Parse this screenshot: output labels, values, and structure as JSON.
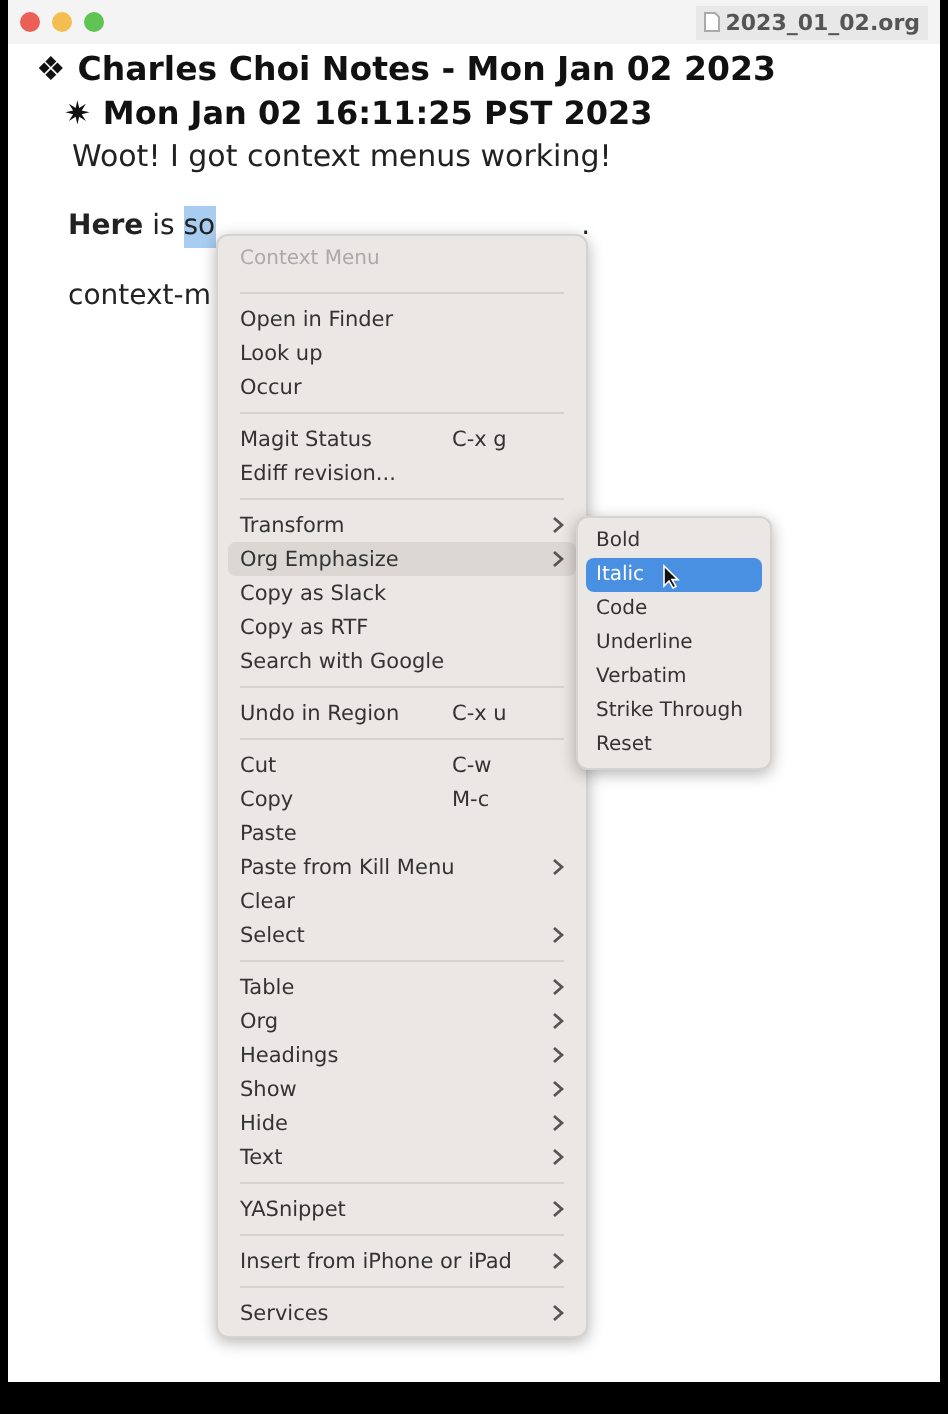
{
  "window": {
    "title": "2023_01_02.org"
  },
  "document": {
    "heading_1": {
      "bullet": "❖",
      "text": "Charles Choi Notes - Mon Jan 02 2023"
    },
    "heading_2": {
      "bullet": "✷",
      "text": "Mon Jan 02 16:11:25 PST 2023"
    },
    "line_1": "Woot! I got context menus working!",
    "line_2": {
      "bold": "Here",
      "plain": " is ",
      "selected_text": "so",
      "end": "."
    },
    "line_3": "context-m"
  },
  "context_menu": {
    "title": "Context Menu",
    "sections": [
      [
        {
          "label": "Open in Finder",
          "submenu": false,
          "selected": false
        },
        {
          "label": "Look up",
          "submenu": false,
          "selected": false
        },
        {
          "label": "Occur",
          "submenu": false,
          "selected": false
        }
      ],
      [
        {
          "label": "Magit Status",
          "shortcut": "C-x g",
          "submenu": false,
          "selected": false
        },
        {
          "label": "Ediff revision...",
          "submenu": false,
          "selected": false
        }
      ],
      [
        {
          "label": "Transform",
          "submenu": true,
          "selected": false
        },
        {
          "label": "Org Emphasize",
          "submenu": true,
          "selected": true
        },
        {
          "label": "Copy as Slack",
          "submenu": false,
          "selected": false
        },
        {
          "label": "Copy as RTF",
          "submenu": false,
          "selected": false
        },
        {
          "label": "Search with Google",
          "submenu": false,
          "selected": false
        }
      ],
      [
        {
          "label": "Undo in Region",
          "shortcut": "C-x u",
          "submenu": false,
          "selected": false
        }
      ],
      [
        {
          "label": "Cut",
          "shortcut": "C-w",
          "submenu": false,
          "selected": false
        },
        {
          "label": "Copy",
          "shortcut": "M-c",
          "submenu": false,
          "selected": false
        },
        {
          "label": "Paste",
          "submenu": false,
          "selected": false
        },
        {
          "label": "Paste from Kill Menu",
          "submenu": true,
          "selected": false
        },
        {
          "label": "Clear",
          "submenu": false,
          "selected": false
        },
        {
          "label": "Select",
          "submenu": true,
          "selected": false
        }
      ],
      [
        {
          "label": "Table",
          "submenu": true,
          "selected": false
        },
        {
          "label": "Org",
          "submenu": true,
          "selected": false
        },
        {
          "label": "Headings",
          "submenu": true,
          "selected": false
        },
        {
          "label": "Show",
          "submenu": true,
          "selected": false
        },
        {
          "label": "Hide",
          "submenu": true,
          "selected": false
        },
        {
          "label": "Text",
          "submenu": true,
          "selected": false
        }
      ],
      [
        {
          "label": "YASnippet",
          "submenu": true,
          "selected": false
        }
      ],
      [
        {
          "label": "Insert from iPhone or iPad",
          "submenu": true,
          "selected": false
        }
      ],
      [
        {
          "label": "Services",
          "submenu": true,
          "selected": false
        }
      ]
    ]
  },
  "submenu": {
    "items": [
      {
        "label": "Bold",
        "selected": false
      },
      {
        "label": "Italic",
        "selected": true
      },
      {
        "label": "Code",
        "selected": false
      },
      {
        "label": "Underline",
        "selected": false
      },
      {
        "label": "Verbatim",
        "selected": false
      },
      {
        "label": "Strike Through",
        "selected": false
      },
      {
        "label": "Reset",
        "selected": false
      }
    ]
  }
}
